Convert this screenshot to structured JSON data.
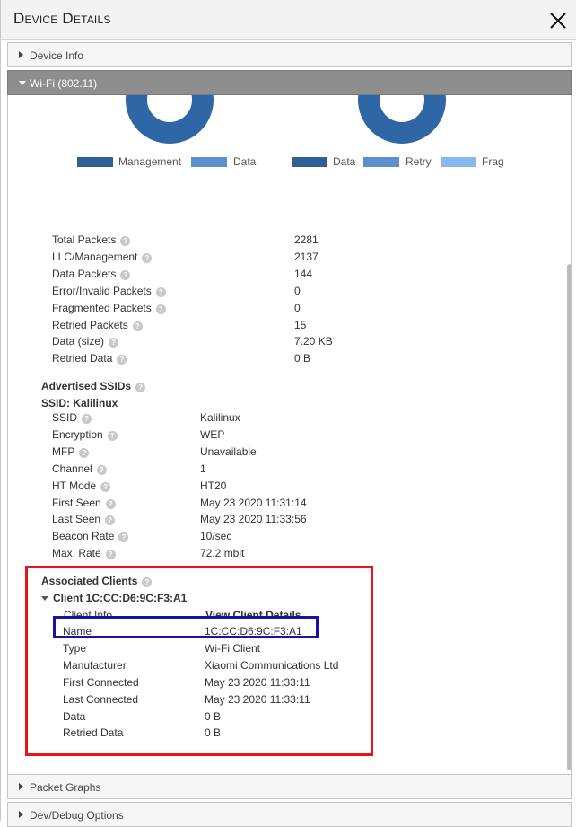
{
  "title": "Device Details",
  "accordion": {
    "device_info": "Device Info",
    "wifi": "Wi-Fi (802.11)",
    "packet_graphs": "Packet Graphs",
    "dev_debug": "Dev/Debug Options"
  },
  "charts": [
    {
      "legend": [
        {
          "label": "Management",
          "color": "#2f5f96"
        },
        {
          "label": "Data",
          "color": "#5b8fd0"
        }
      ]
    },
    {
      "legend": [
        {
          "label": "Data",
          "color": "#2f5f96"
        },
        {
          "label": "Retry",
          "color": "#5b8fd0"
        },
        {
          "label": "Frag",
          "color": "#87b8f0"
        }
      ]
    }
  ],
  "stats": [
    {
      "label": "Total Packets",
      "value": "2281"
    },
    {
      "label": "LLC/Management",
      "value": "2137"
    },
    {
      "label": "Data Packets",
      "value": "144"
    },
    {
      "label": "Error/Invalid Packets",
      "value": "0"
    },
    {
      "label": "Fragmented Packets",
      "value": "0"
    },
    {
      "label": "Retried Packets",
      "value": "15"
    },
    {
      "label": "Data (size)",
      "value": "7.20 KB"
    },
    {
      "label": "Retried Data",
      "value": "0 B"
    }
  ],
  "ssids": {
    "heading": "Advertised SSIDs",
    "ssid_heading": "SSID: Kalilinux",
    "rows": [
      {
        "label": "SSID",
        "value": "Kalilinux"
      },
      {
        "label": "Encryption",
        "value": "WEP"
      },
      {
        "label": "MFP",
        "value": "Unavailable"
      },
      {
        "label": "Channel",
        "value": "1"
      },
      {
        "label": "HT Mode",
        "value": "HT20"
      },
      {
        "label": "First Seen",
        "value": "May 23 2020 11:31:14"
      },
      {
        "label": "Last Seen",
        "value": "May 23 2020 11:33:56"
      },
      {
        "label": "Beacon Rate",
        "value": "10/sec"
      },
      {
        "label": "Max. Rate",
        "value": "72.2 mbit"
      }
    ]
  },
  "clients": {
    "heading": "Associated Clients",
    "client_heading": "Client 1C:CC:D6:9C:F3:A1",
    "info_label": "Client Info",
    "info_link": "View Client Details",
    "rows": [
      {
        "label": "Name",
        "value": "1C:CC:D6:9C:F3:A1"
      },
      {
        "label": "Type",
        "value": "Wi-Fi Client"
      },
      {
        "label": "Manufacturer",
        "value": "Xiaomi Communications Ltd"
      },
      {
        "label": "First Connected",
        "value": "May 23 2020 11:33:11"
      },
      {
        "label": "Last Connected",
        "value": "May 23 2020 11:33:11"
      },
      {
        "label": "Data",
        "value": "0 B"
      },
      {
        "label": "Retried Data",
        "value": "0 B"
      }
    ]
  },
  "colors": {
    "highlight_red": "#e8141b",
    "highlight_blue": "#1514a6",
    "donut": "#2f66a6"
  }
}
